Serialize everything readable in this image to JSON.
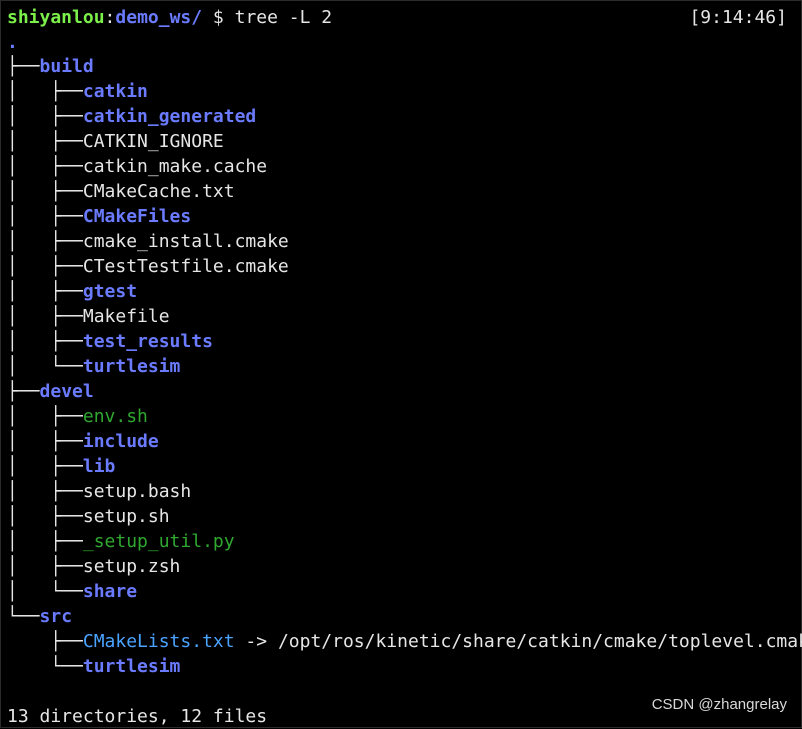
{
  "prompt": {
    "user": "shiyanlou",
    "colon": ":",
    "path": "demo_ws/",
    "symbol": " $ ",
    "command": "tree -L 2"
  },
  "clock": "[9:14:46]",
  "root": ".",
  "tree": {
    "build": {
      "label": "build",
      "guide": "├──",
      "children": [
        {
          "guide": "│   ├──",
          "label": "catkin",
          "kind": "dir"
        },
        {
          "guide": "│   ├──",
          "label": "catkin_generated",
          "kind": "dir"
        },
        {
          "guide": "│   ├──",
          "label": "CATKIN_IGNORE",
          "kind": "file"
        },
        {
          "guide": "│   ├──",
          "label": "catkin_make.cache",
          "kind": "file"
        },
        {
          "guide": "│   ├──",
          "label": "CMakeCache.txt",
          "kind": "file"
        },
        {
          "guide": "│   ├──",
          "label": "CMakeFiles",
          "kind": "dir"
        },
        {
          "guide": "│   ├──",
          "label": "cmake_install.cmake",
          "kind": "file"
        },
        {
          "guide": "│   ├──",
          "label": "CTestTestfile.cmake",
          "kind": "file"
        },
        {
          "guide": "│   ├──",
          "label": "gtest",
          "kind": "dir"
        },
        {
          "guide": "│   ├──",
          "label": "Makefile",
          "kind": "file"
        },
        {
          "guide": "│   ├──",
          "label": "test_results",
          "kind": "dir"
        },
        {
          "guide": "│   └──",
          "label": "turtlesim",
          "kind": "dir"
        }
      ]
    },
    "devel": {
      "label": "devel",
      "guide": "├──",
      "children": [
        {
          "guide": "│   ├──",
          "label": "env.sh",
          "kind": "exec"
        },
        {
          "guide": "│   ├──",
          "label": "include",
          "kind": "dir"
        },
        {
          "guide": "│   ├──",
          "label": "lib",
          "kind": "dir"
        },
        {
          "guide": "│   ├──",
          "label": "setup.bash",
          "kind": "file"
        },
        {
          "guide": "│   ├──",
          "label": "setup.sh",
          "kind": "file"
        },
        {
          "guide": "│   ├──",
          "label": "_setup_util.py",
          "kind": "exec"
        },
        {
          "guide": "│   ├──",
          "label": "setup.zsh",
          "kind": "file"
        },
        {
          "guide": "│   └──",
          "label": "share",
          "kind": "dir"
        }
      ]
    },
    "src": {
      "label": "src",
      "guide": "└──",
      "children": [
        {
          "guide": "    ├──",
          "label": "CMakeLists.txt",
          "kind": "link",
          "arrow": " -> ",
          "target": "/opt/ros/kinetic/share/catkin/cmake/toplevel.cmake"
        },
        {
          "guide": "    └──",
          "label": "turtlesim",
          "kind": "dir"
        }
      ]
    }
  },
  "summary": "13 directories, 12 files",
  "watermark": "CSDN @zhangrelay",
  "colors": {
    "background": "#000000",
    "prompt_user": "#7cf04a",
    "directory": "#6b7bff",
    "executable": "#2fa82f",
    "symlink": "#4aa3ff",
    "text": "#e6e6e6"
  }
}
